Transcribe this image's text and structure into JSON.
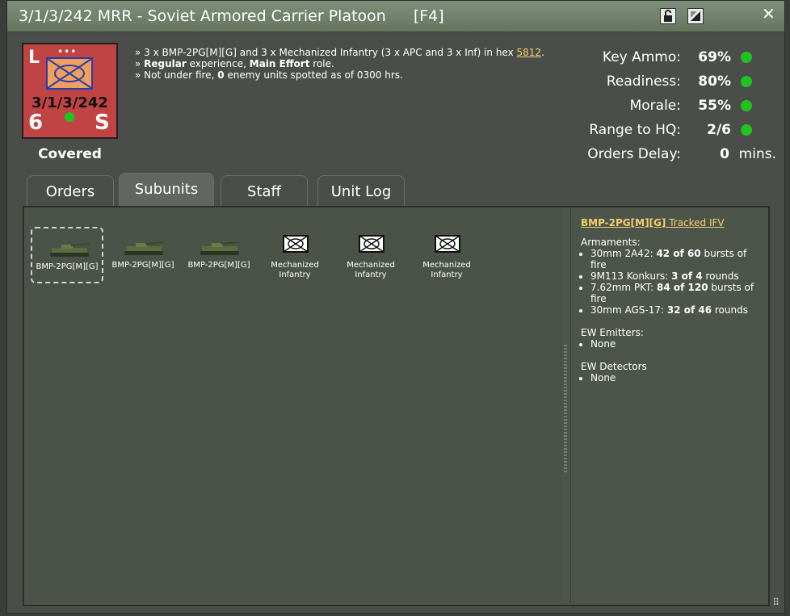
{
  "window": {
    "title": "3/1/3/242 MRR - Soviet Armored Carrier Platoon",
    "hotkey": "[F4]",
    "close_label": "✕"
  },
  "counter": {
    "top_left": "L",
    "designation": "3/1/3/242",
    "bottom_left": "6",
    "bottom_right": "S",
    "dots": "•••",
    "status": "Covered"
  },
  "summary": {
    "line1_prefix": "» 3 x BMP-2PG[M][G] and 3 x Mechanized Infantry (3 x APC and 3 x Inf) in hex ",
    "hex_link": "5812",
    "line1_suffix": ".",
    "line2_exp": "Regular",
    "line2_mid": " experience, ",
    "line2_role": "Main Effort",
    "line2_suffix": " role.",
    "line3_prefix": "» Not under fire, ",
    "line3_count": "0",
    "line3_suffix": " enemy units spotted as of 0300 hrs.",
    "line2_marker": "» "
  },
  "stats": [
    {
      "label": "Key Ammo:",
      "value": "69%",
      "color": "#20c420"
    },
    {
      "label": "Readiness:",
      "value": "80%",
      "color": "#20c420"
    },
    {
      "label": "Morale:",
      "value": "55%",
      "color": "#20c420"
    },
    {
      "label": "Range to HQ:",
      "value": "2/6",
      "color": "#20c420"
    },
    {
      "label": "Orders Delay:",
      "value": "0",
      "unit": "mins."
    }
  ],
  "tabs": [
    {
      "label": "Orders",
      "active": false
    },
    {
      "label": "Subunits",
      "active": true
    },
    {
      "label": "Staff",
      "active": false
    },
    {
      "label": "Unit Log",
      "active": false
    }
  ],
  "subunits": [
    {
      "type": "vehicle",
      "label": "BMP-2PG[M][G]",
      "selected": true
    },
    {
      "type": "vehicle",
      "label": "BMP-2PG[M][G]",
      "selected": false
    },
    {
      "type": "vehicle",
      "label": "BMP-2PG[M][G]",
      "selected": false
    },
    {
      "type": "infantry",
      "label": "Mechanized Infantry",
      "selected": false
    },
    {
      "type": "infantry",
      "label": "Mechanized Infantry",
      "selected": false
    },
    {
      "type": "infantry",
      "label": "Mechanized Infantry",
      "selected": false
    }
  ],
  "detail": {
    "name_link": "BMP-2PG[M][G]",
    "name_suffix": " Tracked IFV",
    "armaments_title": "Armaments:",
    "armaments": [
      {
        "name": "30mm 2A42: ",
        "qty": "42 of 60",
        "unit": " bursts of fire"
      },
      {
        "name": "9M113 Konkurs: ",
        "qty": "3 of 4",
        "unit": " rounds"
      },
      {
        "name": "7.62mm PKT: ",
        "qty": "84 of 120",
        "unit": " bursts of fire"
      },
      {
        "name": "30mm AGS-17: ",
        "qty": "32 of 46",
        "unit": " rounds"
      }
    ],
    "emitters_title": "EW Emitters:",
    "emitters": [
      "None"
    ],
    "detectors_title": "EW Detectors",
    "detectors": [
      "None"
    ]
  }
}
